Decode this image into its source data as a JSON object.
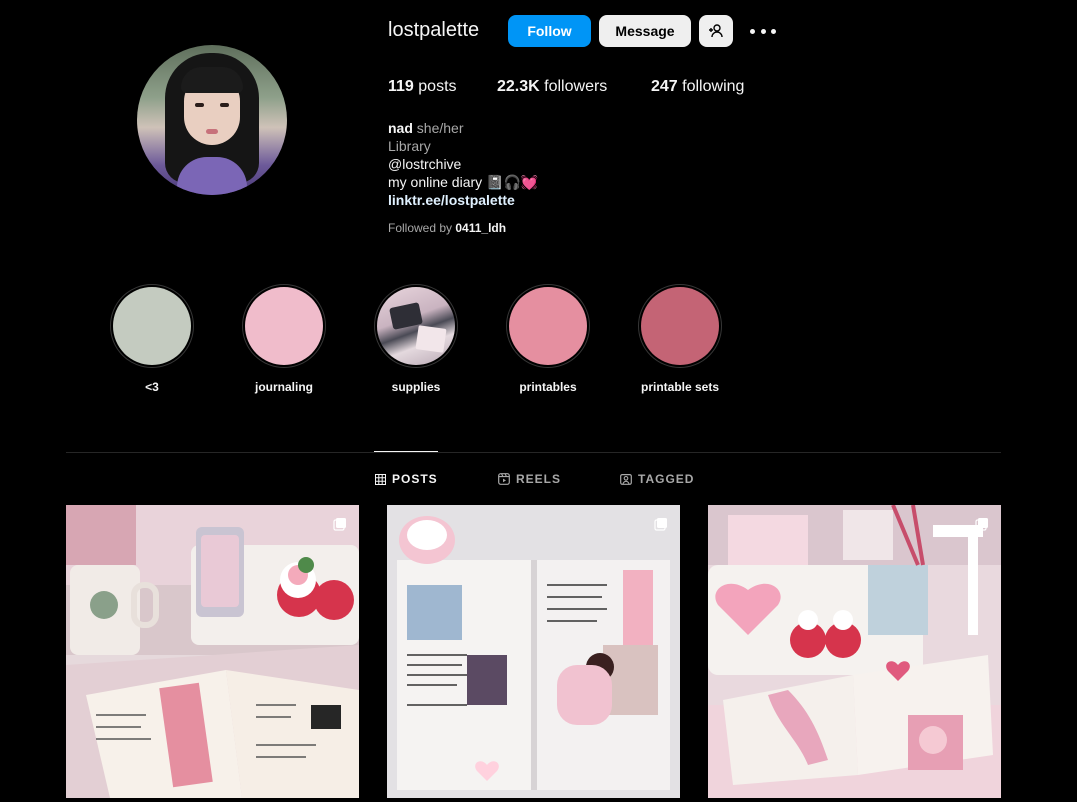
{
  "profile": {
    "username": "lostpalette",
    "follow_label": "Follow",
    "message_label": "Message",
    "stats": {
      "posts_count": "119",
      "posts_label": "posts",
      "followers_count": "22.3K",
      "followers_label": "followers",
      "following_count": "247",
      "following_label": "following"
    },
    "bio": {
      "name": "nad",
      "pronouns": "she/her",
      "category": "Library",
      "mention": "@lostrchive",
      "text": "my online diary 📓🎧💓",
      "link": "linktr.ee/lostpalette"
    },
    "followed_by_label": "Followed by",
    "followed_by_user": "0411_ldh"
  },
  "highlights": [
    {
      "label": "<3",
      "color": "#c4cbc0"
    },
    {
      "label": "journaling",
      "color": "#f0bccb"
    },
    {
      "label": "supplies",
      "color": "#d8c9d2"
    },
    {
      "label": "printables",
      "color": "#e58fa0"
    },
    {
      "label": "printable sets",
      "color": "#c46475"
    }
  ],
  "tabs": [
    {
      "label": "POSTS",
      "active": true,
      "icon": "grid-icon"
    },
    {
      "label": "REELS",
      "active": false,
      "icon": "reels-icon"
    },
    {
      "label": "TAGGED",
      "active": false,
      "icon": "tagged-icon"
    }
  ],
  "posts": [
    {
      "type": "carousel",
      "icon": "multiple-posts-icon"
    },
    {
      "type": "carousel",
      "icon": "multiple-posts-icon"
    },
    {
      "type": "carousel",
      "icon": "multiple-posts-icon"
    }
  ],
  "colors": {
    "background": "#000000",
    "accent": "#0095f6",
    "link": "#e0f1ff",
    "muted_text": "#a8a8a8",
    "divider": "#262626"
  }
}
